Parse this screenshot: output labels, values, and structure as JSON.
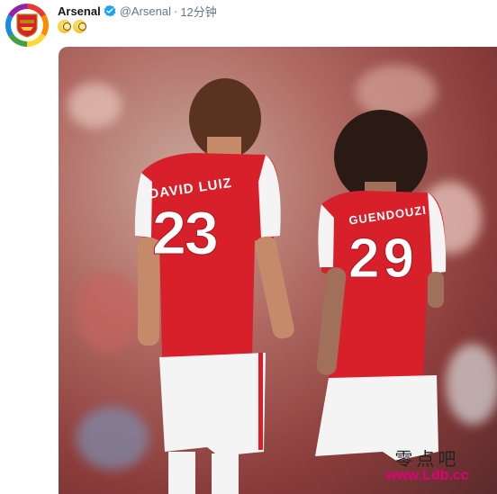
{
  "tweet": {
    "author_name": "Arsenal",
    "handle": "@Arsenal",
    "separator": "·",
    "time": "12分钟",
    "reaction_icons": [
      "monocle-face-icon",
      "monocle-face-icon"
    ]
  },
  "photo": {
    "player_left": {
      "name": "DAVID LUIZ",
      "number": "23"
    },
    "player_right": {
      "name": "GUENDOUZI",
      "number": "29"
    },
    "kit_colors": {
      "red": "#d8202b",
      "white": "#f4f4f4"
    }
  },
  "watermark": {
    "chinese": "零点吧",
    "url": "www.Ldb.cc"
  },
  "colors": {
    "verified": "#1da1f2",
    "text_primary": "#14171a",
    "text_secondary": "#657786"
  }
}
